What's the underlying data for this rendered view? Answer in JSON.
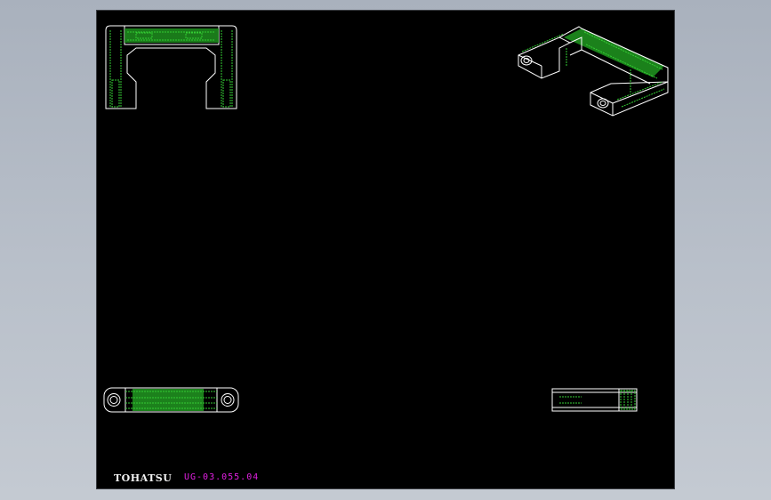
{
  "drawing": {
    "brand_text": "TOHATSU",
    "drawing_number": "UG-03.055.04"
  },
  "views": [
    {
      "name": "front-view"
    },
    {
      "name": "isometric-view"
    },
    {
      "name": "top-view"
    },
    {
      "name": "side-view"
    }
  ],
  "colors": {
    "background": "#000000",
    "outline": "#ffffff",
    "hidden_edge": "#33cc33",
    "annotation": "#e020e0",
    "viewport_frame": "#a9b1bd"
  }
}
